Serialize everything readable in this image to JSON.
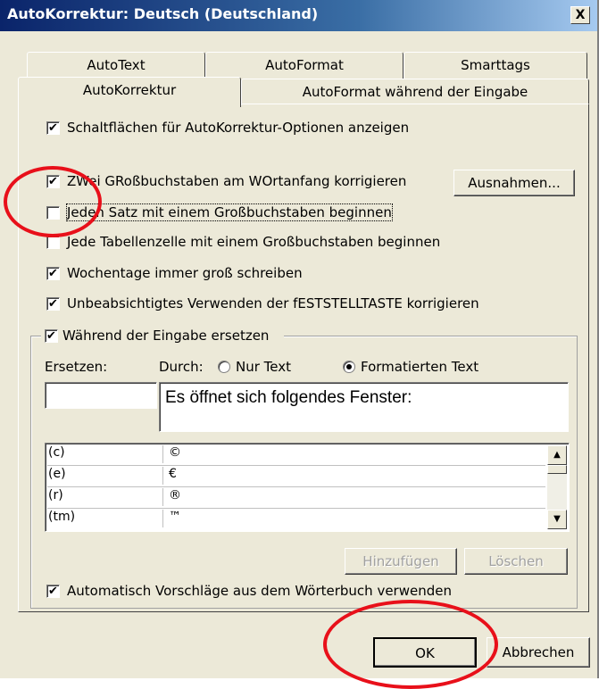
{
  "window": {
    "title": "AutoKorrektur: Deutsch (Deutschland)",
    "close_label": "X"
  },
  "tabs": {
    "row1": [
      "AutoText",
      "AutoFormat",
      "Smarttags"
    ],
    "row2": [
      "AutoKorrektur",
      "AutoFormat während der Eingabe"
    ],
    "active": "AutoKorrektur"
  },
  "options": {
    "show_buttons": {
      "label": "Schaltflächen für AutoKorrektur-Optionen anzeigen",
      "checked": true
    },
    "two_caps": {
      "label": "ZWei GRoßbuchstaben am WOrtanfang korrigieren",
      "checked": true
    },
    "sentence_caps": {
      "label": "Jeden Satz mit einem Großbuchstaben beginnen",
      "checked": false
    },
    "table_caps": {
      "label": "Jede Tabellenzelle mit einem Großbuchstaben beginnen",
      "checked": false
    },
    "weekdays": {
      "label": "Wochentage immer groß schreiben",
      "checked": true
    },
    "capslock": {
      "label": "Unbeabsichtigtes Verwenden der fESTSTELLTASTE korrigieren",
      "checked": true
    },
    "replace_while_typing": {
      "label": "Während der Eingabe ersetzen",
      "checked": true
    },
    "auto_suggest": {
      "label": "Automatisch Vorschläge aus dem Wörterbuch verwenden",
      "checked": true
    }
  },
  "check_mark": "✔",
  "buttons": {
    "exceptions": "Ausnahmen...",
    "add": "Hinzufügen",
    "delete": "Löschen",
    "ok": "OK",
    "cancel": "Abbrechen"
  },
  "replace": {
    "replace_label": "Ersetzen:",
    "with_label": "Durch:",
    "plain_text_label": "Nur Text",
    "formatted_text_label": "Formatierten Text",
    "selected_format": "Formatierten Text",
    "replace_value": "",
    "with_value": "Es öffnet sich folgendes Fenster:"
  },
  "entries": [
    {
      "from": "(c)",
      "to": "©"
    },
    {
      "from": "(e)",
      "to": "€"
    },
    {
      "from": "(r)",
      "to": "®"
    },
    {
      "from": "(tm)",
      "to": "™"
    }
  ],
  "scroll": {
    "up_icon": "▲",
    "down_icon": "▼"
  },
  "colors": {
    "title_bar": "#0a246a",
    "dialog_bg": "#ece9d8",
    "highlight_circle": "#e8101a"
  }
}
